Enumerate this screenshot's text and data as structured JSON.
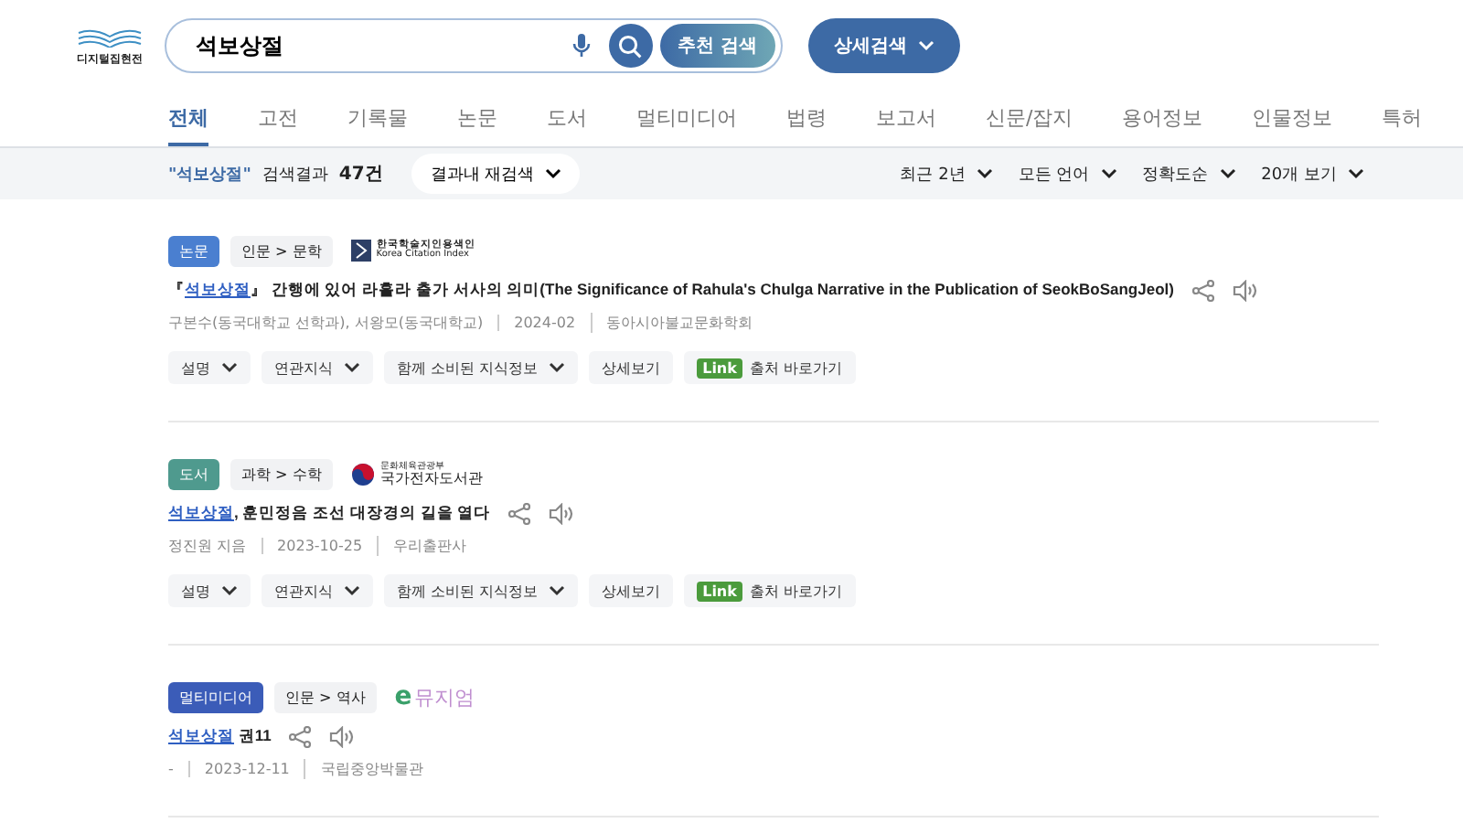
{
  "logo": {
    "text": "디지털집현전"
  },
  "search": {
    "value": "석보상절",
    "recommend_button": "추천 검색",
    "advanced_button": "상세검색"
  },
  "tabs": [
    {
      "label": "전체",
      "selected": true
    },
    {
      "label": "고전",
      "selected": false
    },
    {
      "label": "기록물",
      "selected": false
    },
    {
      "label": "논문",
      "selected": false
    },
    {
      "label": "도서",
      "selected": false
    },
    {
      "label": "멀티미디어",
      "selected": false
    },
    {
      "label": "법령",
      "selected": false
    },
    {
      "label": "보고서",
      "selected": false
    },
    {
      "label": "신문/잡지",
      "selected": false
    },
    {
      "label": "용어정보",
      "selected": false
    },
    {
      "label": "인물정보",
      "selected": false
    },
    {
      "label": "특허",
      "selected": false
    }
  ],
  "result_bar": {
    "query": "\"석보상절\"",
    "label": "검색결과",
    "count": "47건",
    "refine": "결과내 재검색",
    "filters": [
      "최근 2년",
      "모든 언어",
      "정확도순",
      "20개 보기"
    ]
  },
  "results": [
    {
      "type": "논문",
      "color": "#4a7fd0",
      "category": "인문 > 문학",
      "source": {
        "kind": "kci",
        "name": "한국학술지인용색인",
        "subname": "Korea Citation Index"
      },
      "title_prefix": "『",
      "keyword": "석보상절",
      "title_rest": "』 간행에 있어 라훌라 출가 서사의 의미(The Significance of Rahula's Chulga Narrative in the Publication of SeokBoSangJeol)",
      "meta": [
        "구본수(동국대학교 선학과), 서왕모(동국대학교)",
        "2024-02",
        "동아시아불교문화학회"
      ],
      "actions": [
        {
          "kind": "dropdown",
          "label": "설명"
        },
        {
          "kind": "dropdown",
          "label": "연관지식"
        },
        {
          "kind": "dropdown",
          "label": "함께 소비된 지식정보"
        },
        {
          "kind": "plain",
          "label": "상세보기"
        },
        {
          "kind": "link",
          "badge": "Link",
          "label": "출처 바로가기"
        }
      ]
    },
    {
      "type": "도서",
      "color": "#4f9a8e",
      "category": "과학 > 수학",
      "source": {
        "kind": "gov",
        "name": "국가전자도서관",
        "subname": "문화체육관광부"
      },
      "keyword": "석보상절",
      "title_rest": ", 훈민정음 조선 대장경의 길을 열다",
      "meta": [
        "정진원 지음",
        "2023-10-25",
        "우리출판사"
      ],
      "actions": [
        {
          "kind": "dropdown",
          "label": "설명"
        },
        {
          "kind": "dropdown",
          "label": "연관지식"
        },
        {
          "kind": "dropdown",
          "label": "함께 소비된 지식정보"
        },
        {
          "kind": "plain",
          "label": "상세보기"
        },
        {
          "kind": "link",
          "badge": "Link",
          "label": "출처 바로가기"
        }
      ]
    },
    {
      "type": "멀티미디어",
      "color": "#3b5cb8",
      "category": "인문 > 역사",
      "source": {
        "kind": "emuseum",
        "name": "뮤지엄",
        "mark": "e"
      },
      "keyword": "석보상절",
      "title_rest": " 권11",
      "meta": [
        "-",
        "2023-12-11",
        "국립중앙박물관"
      ]
    }
  ]
}
